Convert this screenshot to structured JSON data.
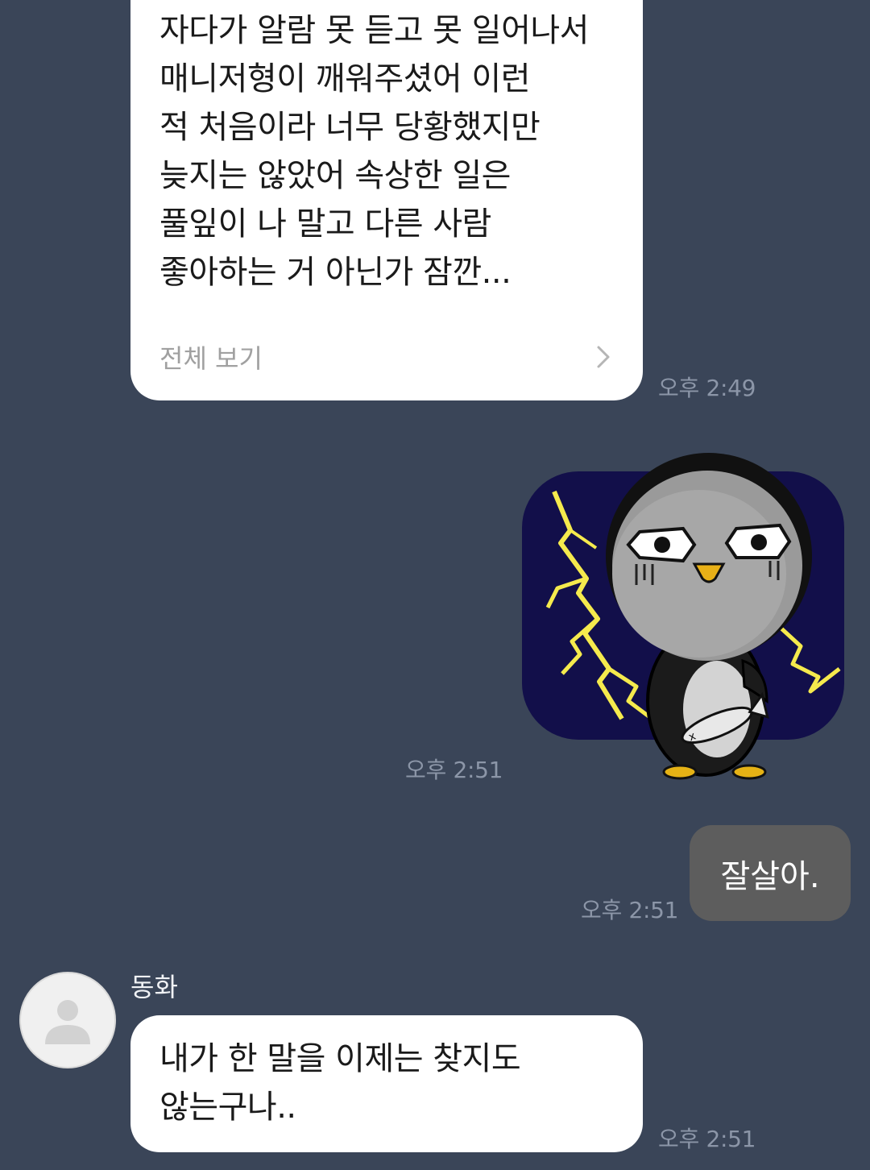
{
  "messages": {
    "m1": {
      "text": "자다가 알람 못 듣고 못 일어나서\n매니저형이 깨워주셨어 이런\n적 처음이라 너무 당황했지만\n늦지는 않았어 속상한 일은\n풀잎이 나 말고 다른 사람\n좋아하는 거 아닌가 잠깐...",
      "see_all": "전체 보기",
      "time": "오후 2:49"
    },
    "m2": {
      "sticker": "penguin-lightning-sticker",
      "time": "오후 2:51"
    },
    "m3": {
      "text": "잘살아.",
      "time": "오후 2:51"
    },
    "m4": {
      "sender": "동화",
      "text": "내가 한 말을 이제는 찾지도\n않는구나..",
      "time": "오후 2:51"
    }
  },
  "colors": {
    "background": "#3a4558",
    "incoming_bubble": "#ffffff",
    "outgoing_bubble": "#5d5d5d",
    "timestamp": "#8c96a8"
  },
  "icons": {
    "see_all_chevron": "chevron-right-icon",
    "avatar_placeholder": "person-icon"
  }
}
